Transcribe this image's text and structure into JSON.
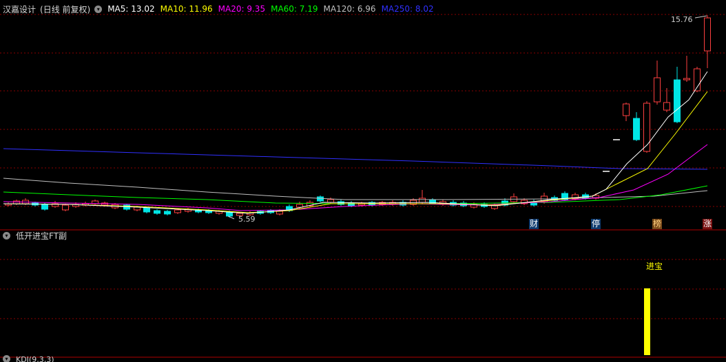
{
  "main_chart": {
    "stock_name": "汉嘉设计",
    "period_label": "(日线 前复权)",
    "header_icon": "chevron-down-icon",
    "ma_indicators": [
      {
        "label": "MA5: 13.02",
        "color": "#ffffff"
      },
      {
        "label": "MA10: 11.96",
        "color": "#ffff00"
      },
      {
        "label": "MA20: 9.35",
        "color": "#ff00ff"
      },
      {
        "label": "MA60: 7.19",
        "color": "#00ff00"
      },
      {
        "label": "MA120: 6.96",
        "color": "#c0c0c0"
      },
      {
        "label": "MA250: 8.02",
        "color": "#3030ff"
      }
    ],
    "high_label": "15.76",
    "low_label": "5.59",
    "event_badges": [
      {
        "text": "财",
        "bg": "#0e3a6e",
        "fg": "#ffffff"
      },
      {
        "text": "停",
        "bg": "#0e3a6e",
        "fg": "#ffffff"
      },
      {
        "text": "榜",
        "bg": "#7a4a1a",
        "fg": "#ffd080"
      },
      {
        "text": "涨",
        "bg": "#7a1010",
        "fg": "#ffffff"
      }
    ],
    "colors": {
      "up": "#ff4040",
      "down": "#00e5e5",
      "grid": "#8b0000",
      "bg": "#000000"
    }
  },
  "sub_chart": {
    "indicator_name": "低开进宝FT副",
    "header_icon": "chevron-down-icon",
    "signal_label": "进宝",
    "signal_color": "#ffff00"
  },
  "kdj_header": {
    "label": "KDJ(9,3,3)"
  }
}
